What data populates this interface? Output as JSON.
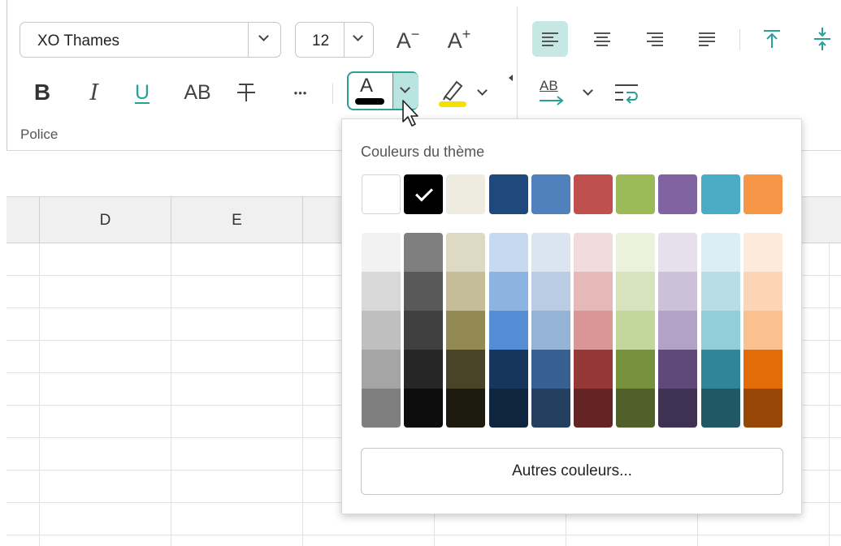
{
  "ribbon": {
    "font_name": "XO Thames",
    "font_size": "12",
    "grow_font_label": "A",
    "grow_font_sup": "+",
    "shrink_font_label": "A",
    "shrink_font_sup": "−",
    "bold_label": "B",
    "italic_label": "I",
    "underline_label": "U",
    "caps_label": "AB",
    "more_label": "•••",
    "font_color_letter": "A",
    "font_color_value": "#000000",
    "highlight_color_value": "#f5e100",
    "group_label": "Police",
    "wrap_label": "AB",
    "accent": "#27a098"
  },
  "grid": {
    "columns": [
      "D",
      "E"
    ]
  },
  "color_popup": {
    "title": "Couleurs du thème",
    "selected_index": 1,
    "theme_colors": [
      "#ffffff",
      "#000000",
      "#eeece1",
      "#1f497d",
      "#4f81bd",
      "#c0504d",
      "#9bbb59",
      "#8064a2",
      "#4bacc6",
      "#f79646"
    ],
    "shades": [
      [
        "#f2f2f2",
        "#d8d8d8",
        "#bfbfbf",
        "#a5a5a5",
        "#7f7f7f"
      ],
      [
        "#7f7f7f",
        "#595959",
        "#3f3f3f",
        "#262626",
        "#0c0c0c"
      ],
      [
        "#ddd9c3",
        "#c4bd97",
        "#938953",
        "#494429",
        "#1d1b10"
      ],
      [
        "#c6d9f0",
        "#8db3e2",
        "#548dd4",
        "#17365d",
        "#0f243e"
      ],
      [
        "#dbe5f1",
        "#b8cce4",
        "#95b3d7",
        "#366092",
        "#244061"
      ],
      [
        "#f2dcdb",
        "#e5b9b7",
        "#d99694",
        "#953734",
        "#632423"
      ],
      [
        "#ebf1dd",
        "#d7e3bc",
        "#c3d69b",
        "#76923c",
        "#4f6128"
      ],
      [
        "#e5e0ec",
        "#ccc1d9",
        "#b2a2c7",
        "#5f497a",
        "#3f3151"
      ],
      [
        "#dbeef3",
        "#b7dde8",
        "#92cddc",
        "#31859b",
        "#205867"
      ],
      [
        "#fdeada",
        "#fbd5b5",
        "#fac08f",
        "#e36c09",
        "#974806"
      ]
    ],
    "more_colors_label": "Autres couleurs..."
  }
}
